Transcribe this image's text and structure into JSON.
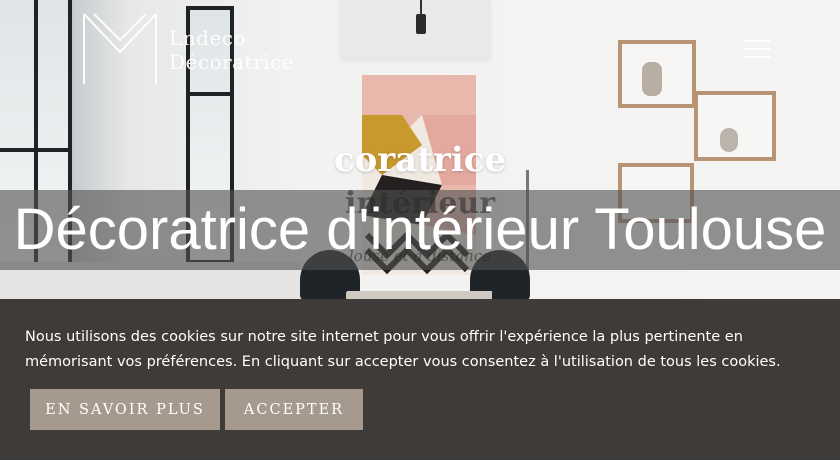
{
  "brand": {
    "name_line1": "Lndeco",
    "name_line2": "Décoratrice"
  },
  "header": {
    "menu_icon": "hamburger-menu-icon"
  },
  "hero": {
    "title_partial": "coratrice",
    "subtitle_partial": "intérieur",
    "tagline_partial": "louse et à distance",
    "headline": "Décoratrice d'intérieur Toulouse"
  },
  "cookie_banner": {
    "text": "Nous utilisons des cookies sur notre site internet pour vous offrir l'expérience la plus pertinente en mémorisant vos préférences. En cliquant sur accepter vous consentez à l'utilisation de tous les cookies.",
    "learn_more_label": "En savoir plus",
    "accept_label": "Accepter",
    "button_color": "#a59a8d",
    "background_color": "#3f3b39"
  }
}
